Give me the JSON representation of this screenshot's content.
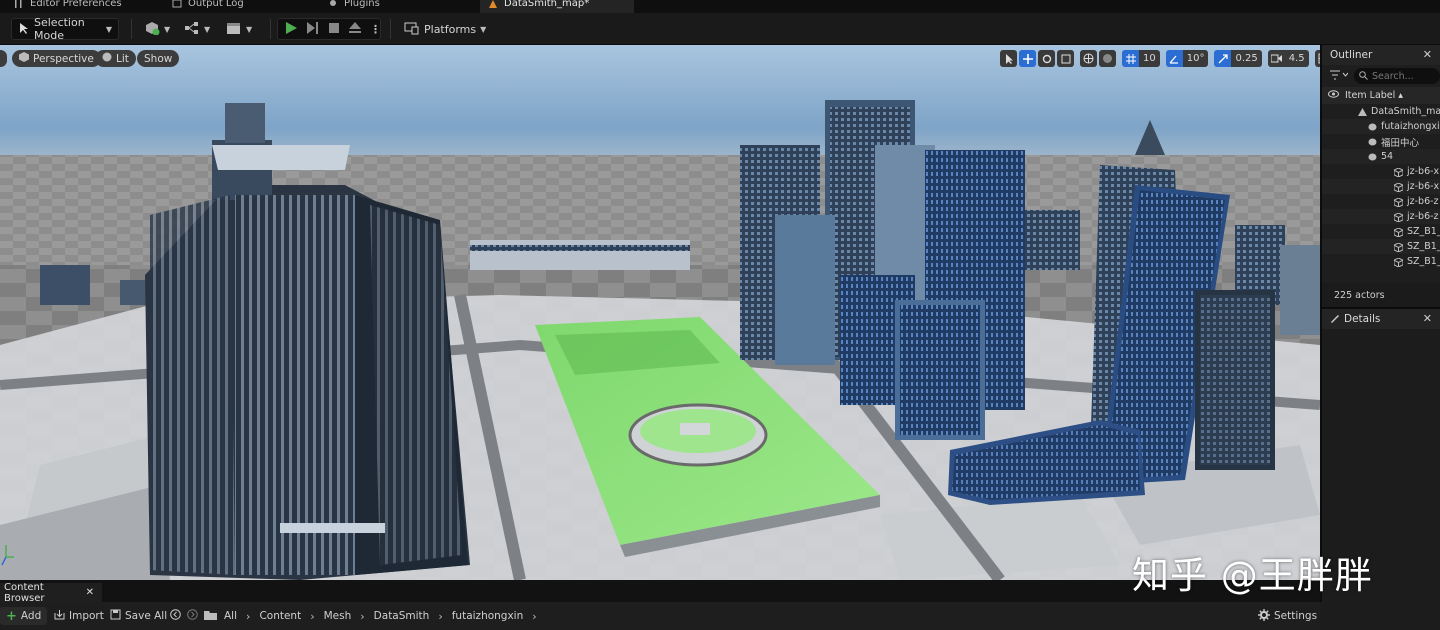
{
  "tabs": [
    {
      "label": "Editor Preferences",
      "icon": "sliders-icon"
    },
    {
      "label": "Output Log",
      "icon": "log-icon"
    },
    {
      "label": "Plugins",
      "icon": "plugin-icon"
    },
    {
      "label": "DataSmith_map*",
      "icon": "level-icon",
      "active": true
    }
  ],
  "toolbar": {
    "mode_label": "Selection Mode",
    "platforms_label": "Platforms"
  },
  "viewport": {
    "perspective_label": "Perspective",
    "lit_label": "Lit",
    "show_label": "Show",
    "grid_snap": "10",
    "rotation_snap": "10°",
    "scale_snap": "0.25",
    "camera_speed": "4.5"
  },
  "outliner": {
    "title": "Outliner",
    "search_placeholder": "Search...",
    "column_label": "Item Label ▴",
    "items": [
      {
        "label": "DataSmith_map",
        "indent": 36,
        "icon": "level-icon"
      },
      {
        "label": "futaizhongxin",
        "indent": 46,
        "icon": "actor-icon"
      },
      {
        "label": "福田中心",
        "indent": 46,
        "icon": "actor-icon"
      },
      {
        "label": "54",
        "indent": 46,
        "icon": "actor-icon"
      },
      {
        "label": "jz-b6-x",
        "indent": 72,
        "icon": "static-mesh-icon"
      },
      {
        "label": "jz-b6-x",
        "indent": 72,
        "icon": "static-mesh-icon"
      },
      {
        "label": "jz-b6-z",
        "indent": 72,
        "icon": "static-mesh-icon"
      },
      {
        "label": "jz-b6-z",
        "indent": 72,
        "icon": "static-mesh-icon"
      },
      {
        "label": "SZ_B1_",
        "indent": 72,
        "icon": "static-mesh-icon"
      },
      {
        "label": "SZ_B1_",
        "indent": 72,
        "icon": "static-mesh-icon"
      },
      {
        "label": "SZ_B1_",
        "indent": 72,
        "icon": "static-mesh-icon"
      }
    ],
    "actor_count": "225 actors"
  },
  "details": {
    "title": "Details"
  },
  "content_browser": {
    "title": "Content Browser",
    "add_label": "Add",
    "import_label": "Import",
    "save_all_label": "Save All",
    "breadcrumbs": [
      "All",
      "Content",
      "Mesh",
      "DataSmith",
      "futaizhongxin"
    ],
    "settings_label": "Settings"
  },
  "watermark": "知乎 @王胖胖",
  "colors": {
    "accent": "#2b6dd3",
    "play": "#4caf50",
    "grass": "#8fe07a"
  }
}
